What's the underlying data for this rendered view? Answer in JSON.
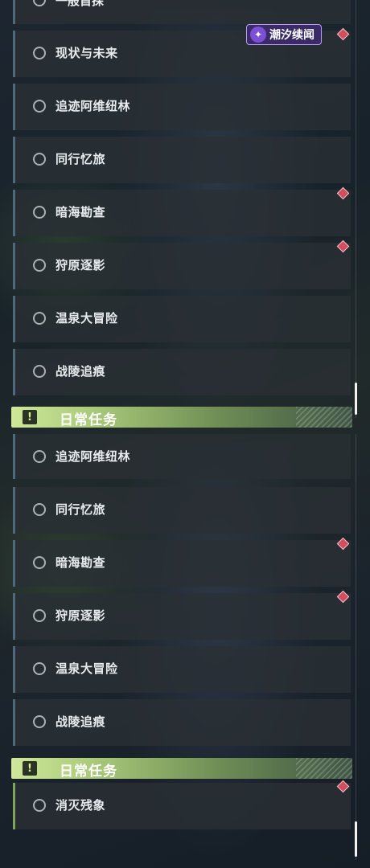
{
  "event_badge": {
    "text": "潮汐续闻",
    "icon": "star-burst-icon",
    "color": "#7b4fd8"
  },
  "top_panel": {
    "partial_item": "一般首探",
    "quests": [
      {
        "label": "现状与未来",
        "alert": false
      },
      {
        "label": "追迹阿维纽林",
        "alert": false
      },
      {
        "label": "同行忆旅",
        "alert": false
      },
      {
        "label": "暗海勘查",
        "alert": true
      },
      {
        "label": "狩原逐影",
        "alert": true
      },
      {
        "label": "温泉大冒险",
        "alert": false
      },
      {
        "label": "战陵追痕",
        "alert": false
      }
    ],
    "section_header": {
      "title": "日常任务",
      "icon": "exclamation-icon"
    }
  },
  "bottom_panel": {
    "quests": [
      {
        "label": "追迹阿维纽林",
        "alert": false
      },
      {
        "label": "同行忆旅",
        "alert": false
      },
      {
        "label": "暗海勘查",
        "alert": true
      },
      {
        "label": "狩原逐影",
        "alert": true
      },
      {
        "label": "温泉大冒险",
        "alert": false
      },
      {
        "label": "战陵追痕",
        "alert": false
      }
    ],
    "section_header": {
      "title": "日常任务",
      "icon": "exclamation-icon"
    },
    "daily_quests": [
      {
        "label": "消灭残象",
        "alert": true
      }
    ]
  },
  "colors": {
    "alert_diamond": "#d24d5e",
    "section_accent": "#cfe89a",
    "quest_border": "#4d6a7c",
    "daily_border": "#7fa35a"
  }
}
